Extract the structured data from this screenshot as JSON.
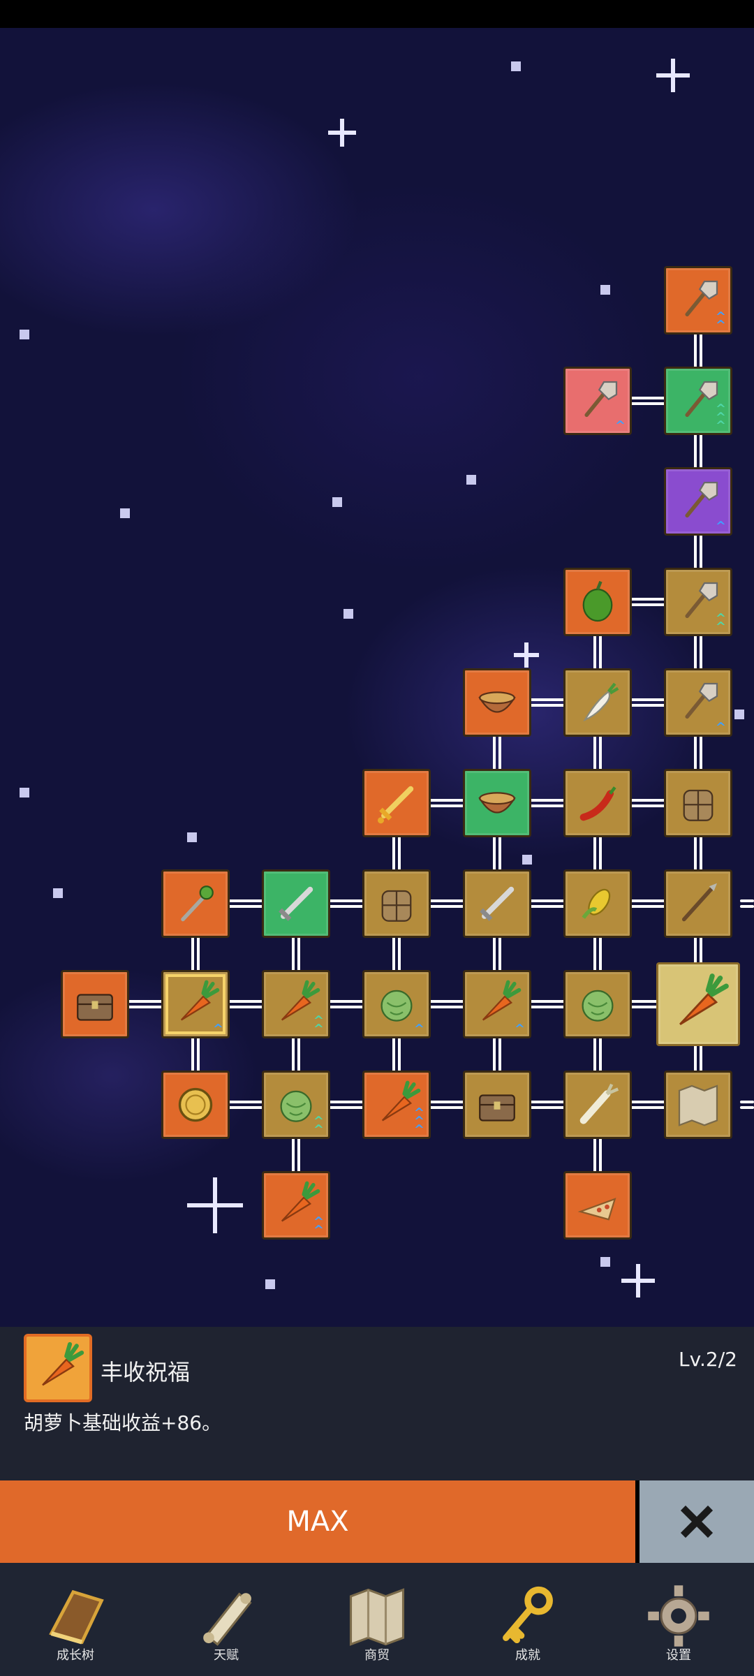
{
  "skill_tree": {
    "nodes": [
      {
        "icon": "shovel-icon",
        "color": "orange",
        "level_arrows": 2
      },
      {
        "icon": "shovel-icon",
        "color": "pink",
        "level_arrows": 1
      },
      {
        "icon": "shovel-icon",
        "color": "green",
        "level_arrows": 3
      },
      {
        "icon": "shovel-icon",
        "color": "purple",
        "level_arrows": 1
      },
      {
        "icon": "bell-pepper-icon",
        "color": "orange"
      },
      {
        "icon": "shovel-icon",
        "color": "gold",
        "level_arrows": 2
      },
      {
        "icon": "bowl-icon",
        "color": "orange"
      },
      {
        "icon": "daikon-icon",
        "color": "gold"
      },
      {
        "icon": "shovel-icon",
        "color": "gold",
        "level_arrows": 1
      },
      {
        "icon": "golden-sword-icon",
        "color": "orange"
      },
      {
        "icon": "bowl-icon",
        "color": "green"
      },
      {
        "icon": "chili-pepper-icon",
        "color": "gold"
      },
      {
        "icon": "backpack-icon",
        "color": "gold"
      },
      {
        "icon": "magic-staff-icon",
        "color": "orange"
      },
      {
        "icon": "sword-icon",
        "color": "green"
      },
      {
        "icon": "backpack-icon",
        "color": "gold"
      },
      {
        "icon": "sword-icon",
        "color": "gold"
      },
      {
        "icon": "corn-icon",
        "color": "gold"
      },
      {
        "icon": "spear-icon",
        "color": "gold"
      },
      {
        "icon": "treasure-chest-icon",
        "color": "orange"
      },
      {
        "icon": "carrot-icon",
        "color": "gold",
        "level_arrows": 1,
        "selected": true
      },
      {
        "icon": "carrot-icon",
        "color": "gold",
        "level_arrows": 2
      },
      {
        "icon": "cabbage-icon",
        "color": "gold",
        "level_arrows": 1
      },
      {
        "icon": "carrot-icon",
        "color": "gold",
        "level_arrows": 1
      },
      {
        "icon": "cabbage-icon",
        "color": "gold"
      },
      {
        "icon": "carrot-icon",
        "color": "gold",
        "root": true
      },
      {
        "icon": "gold-coin-icon",
        "color": "orange"
      },
      {
        "icon": "cabbage-icon",
        "color": "gold",
        "level_arrows": 2
      },
      {
        "icon": "carrot-icon",
        "color": "orange",
        "level_arrows": 3
      },
      {
        "icon": "treasure-chest-icon",
        "color": "gold"
      },
      {
        "icon": "leek-icon",
        "color": "gold"
      },
      {
        "icon": "treasure-map-icon",
        "color": "gold"
      },
      {
        "icon": "carrot-icon",
        "color": "orange",
        "level_arrows": 2
      },
      {
        "icon": "pizza-icon",
        "color": "orange"
      }
    ]
  },
  "detail": {
    "icon": "carrot-icon",
    "name": "丰收祝福",
    "level": "Lv.2/2",
    "description": "胡萝卜基础收益+86。"
  },
  "actions": {
    "max_label": "MAX",
    "close_icon": "close-icon"
  },
  "nav": [
    {
      "label": "成长树",
      "icon": "book-icon"
    },
    {
      "label": "天赋",
      "icon": "scroll-icon"
    },
    {
      "label": "商贸",
      "icon": "map-icon"
    },
    {
      "label": "成就",
      "icon": "key-icon"
    },
    {
      "label": "设置",
      "icon": "gear-icon"
    }
  ],
  "colors": {
    "orange": "#e0692a",
    "gold": "#b48c3c",
    "green": "#3cb466",
    "purple": "#8a4ccf",
    "panel": "#1f2330",
    "nav": "#1f2533"
  }
}
